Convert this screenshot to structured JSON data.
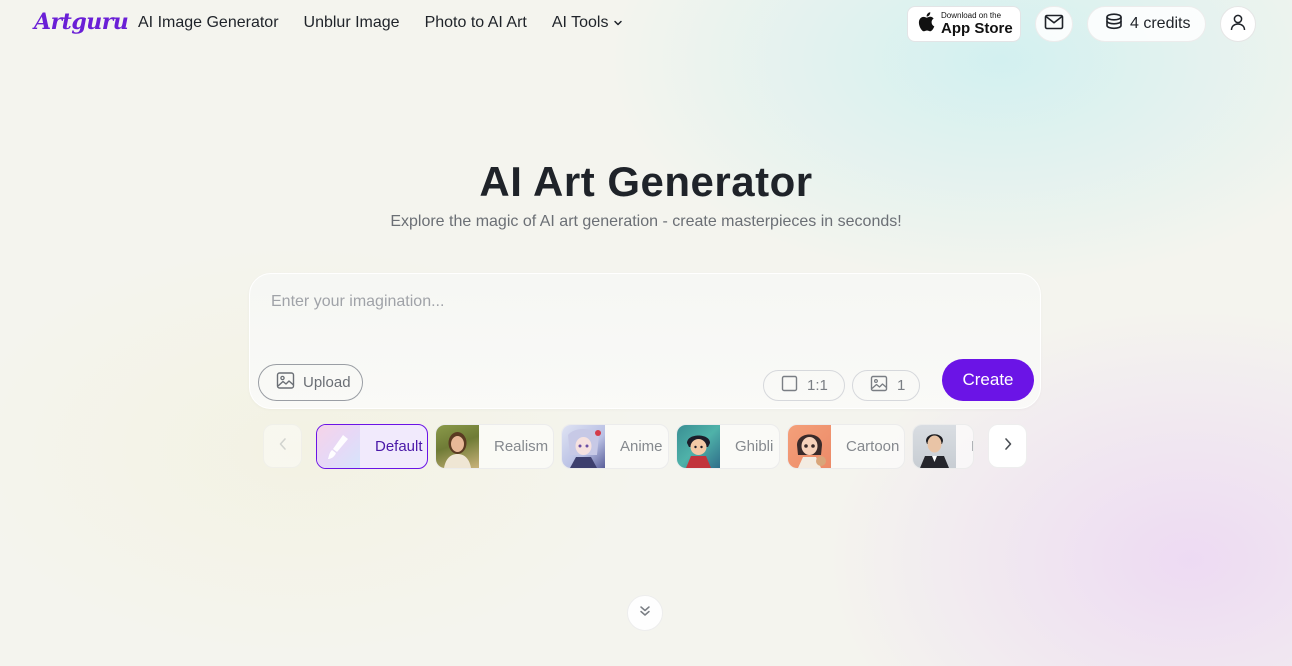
{
  "brand": {
    "logo_text": "Artguru",
    "logo_color": "#6a1fd6"
  },
  "nav": {
    "items": [
      {
        "label": "AI Image Generator"
      },
      {
        "label": "Unblur Image"
      },
      {
        "label": "Photo to AI Art"
      },
      {
        "label": "AI Tools",
        "has_dropdown": true
      }
    ]
  },
  "header_actions": {
    "appstore_small": "Download on the",
    "appstore_big": "App Store",
    "mail_icon": "mail-icon",
    "credits_label": "4 credits",
    "user_icon": "user-icon"
  },
  "hero": {
    "title": "AI Art Generator",
    "subtitle": "Explore the magic of AI art generation - create masterpieces in seconds!"
  },
  "prompt": {
    "placeholder": "Enter your imagination...",
    "value": "",
    "upload_label": "Upload",
    "ratio_label": "1:1",
    "count_label": "1",
    "create_label": "Create",
    "accent": "#6b14e6"
  },
  "styles": {
    "items": [
      {
        "label": "Default",
        "active": true
      },
      {
        "label": "Realism",
        "active": false
      },
      {
        "label": "Anime",
        "active": false
      },
      {
        "label": "Ghibli",
        "active": false
      },
      {
        "label": "Cartoon",
        "active": false
      },
      {
        "label": "I",
        "active": false
      }
    ]
  }
}
